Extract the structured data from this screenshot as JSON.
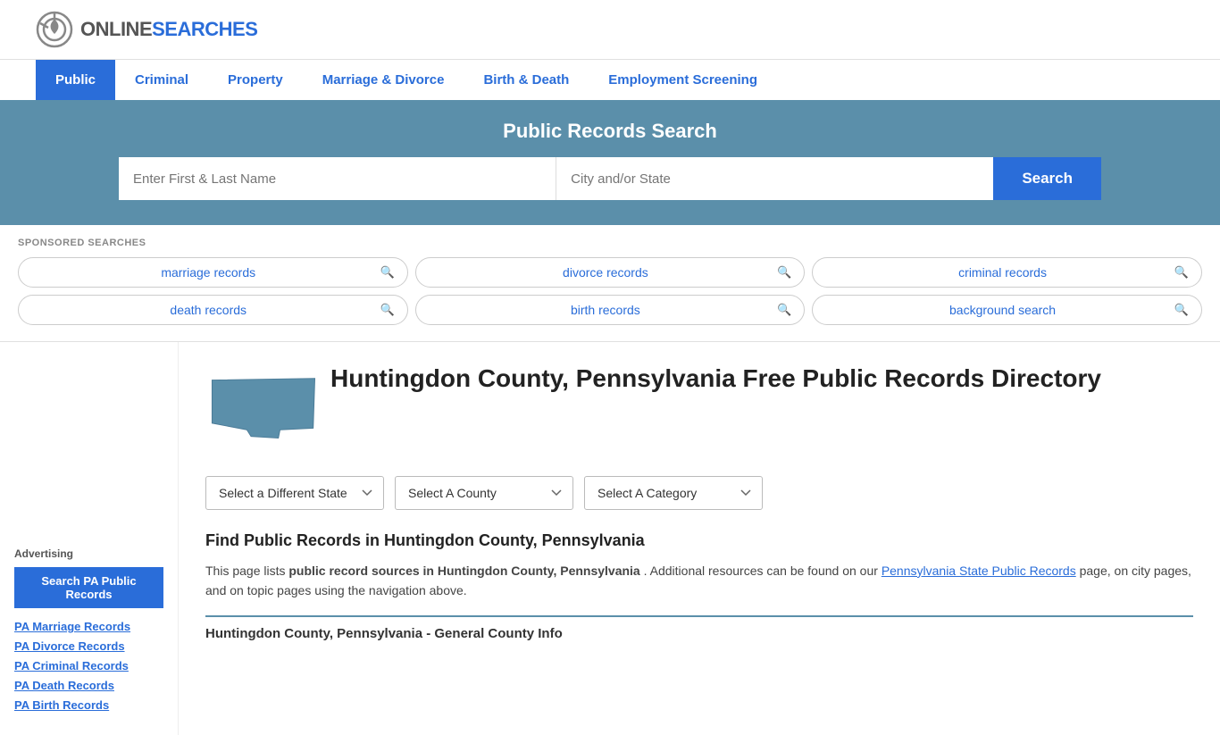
{
  "header": {
    "logo_online": "ONLINE",
    "logo_searches": "SEARCHES"
  },
  "nav": {
    "items": [
      {
        "label": "Public",
        "active": true
      },
      {
        "label": "Criminal",
        "active": false
      },
      {
        "label": "Property",
        "active": false
      },
      {
        "label": "Marriage & Divorce",
        "active": false
      },
      {
        "label": "Birth & Death",
        "active": false
      },
      {
        "label": "Employment Screening",
        "active": false
      }
    ]
  },
  "hero": {
    "title": "Public Records Search",
    "name_placeholder": "Enter First & Last Name",
    "location_placeholder": "City and/or State",
    "search_button": "Search"
  },
  "sponsored": {
    "label": "SPONSORED SEARCHES",
    "items": [
      {
        "text": "marriage records"
      },
      {
        "text": "divorce records"
      },
      {
        "text": "criminal records"
      },
      {
        "text": "death records"
      },
      {
        "text": "birth records"
      },
      {
        "text": "background search"
      }
    ]
  },
  "page": {
    "title": "Huntingdon County, Pennsylvania Free Public Records Directory",
    "state_dropdown": "Select a Different State",
    "county_dropdown": "Select A County",
    "category_dropdown": "Select A Category",
    "find_title": "Find Public Records in Huntingdon County, Pennsylvania",
    "find_text_1": "This page lists ",
    "find_bold": "public record sources in Huntingdon County, Pennsylvania",
    "find_text_2": ". Additional resources can be found on our ",
    "find_link": "Pennsylvania State Public Records",
    "find_text_3": " page, on city pages, and on topic pages using the navigation above.",
    "section_subtitle": "Huntingdon County, Pennsylvania - General County Info"
  },
  "sidebar": {
    "advertising_label": "Advertising",
    "promo_button": "Search PA Public Records",
    "links": [
      {
        "text": "PA Marriage Records"
      },
      {
        "text": "PA Divorce Records"
      },
      {
        "text": "PA Criminal Records"
      },
      {
        "text": "PA Death Records"
      },
      {
        "text": "PA Birth Records"
      }
    ]
  }
}
